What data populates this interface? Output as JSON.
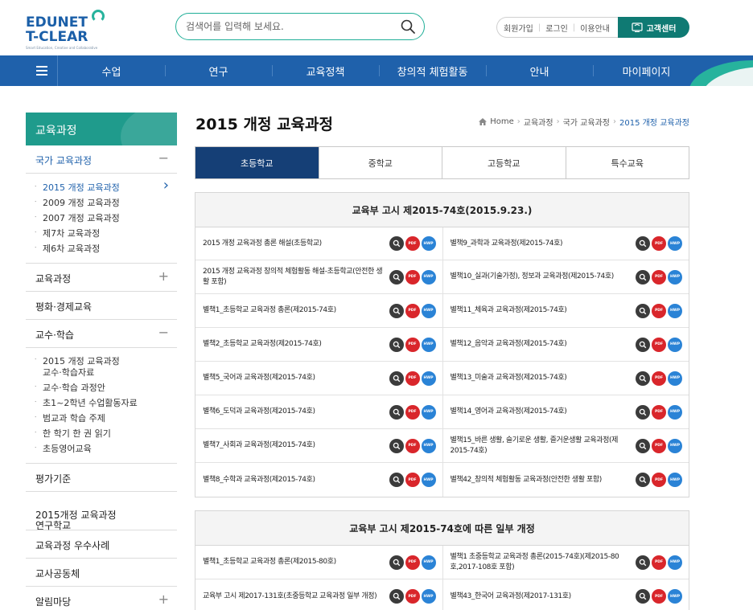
{
  "header": {
    "logo_line1": "EDUNET",
    "logo_line2": "T-CLEAR",
    "logo_tagline": "Smart Education, Creative and Collaborative",
    "search_placeholder": "검색어를 입력해 보세요.",
    "util_links": [
      "회원가입",
      "로그인",
      "이용안내"
    ],
    "customer_center": "고객센터"
  },
  "gnb": {
    "items": [
      "수업",
      "연구",
      "교육정책",
      "창의적 체험활동",
      "안내",
      "마이페이지"
    ]
  },
  "sidebar": {
    "title": "교육과정",
    "groups": [
      {
        "label": "국가 교육과정",
        "toggle": "−",
        "open": true,
        "items": [
          "2015 개정 교육과정",
          "2009 개정 교육과정",
          "2007 개정 교육과정",
          "제7차 교육과정",
          "제6차 교육과정"
        ]
      },
      {
        "label": "교육과정",
        "toggle": "+"
      },
      {
        "label": "평화·경제교육",
        "toggle": ""
      },
      {
        "label": "교수·학습",
        "toggle": "−",
        "open": true,
        "items": [
          "2015 개정 교육과정\n교수·학습자료",
          "교수·학습 과정안",
          "초1~2학년 수업활동자료",
          "범교과 학습 주제",
          "한 학기 한 권 읽기",
          "초등영어교육"
        ]
      },
      {
        "label": "평가기준",
        "toggle": ""
      },
      {
        "label": "2015개정 교육과정\n연구학교",
        "toggle": ""
      },
      {
        "label": "교육과정 우수사례",
        "toggle": ""
      },
      {
        "label": "교사공동체",
        "toggle": ""
      },
      {
        "label": "알림마당",
        "toggle": "+"
      }
    ]
  },
  "page": {
    "title": "2015 개정 교육과정",
    "breadcrumb": [
      "Home",
      "교육과정",
      "국가 교육과정",
      "2015 개정 교육과정"
    ]
  },
  "tabs": [
    "초등학교",
    "중학교",
    "고등학교",
    "특수교육"
  ],
  "icon_labels": {
    "view": "",
    "pdf": "PDF",
    "hwp": "HWP"
  },
  "sections": [
    {
      "heading": "교육부 고시 제2015-74호(2015.9.23.)",
      "rows": [
        [
          "2015 개정 교육과정 총론 해설(초등학교)",
          "별책9_과학과 교육과정(제2015-74호)"
        ],
        [
          "2015 개정 교육과정 창의적 체험활동 해설-초등학교(안전한 생활 포함)",
          "별책10_실과(기술가정), 정보과 교육과정(제2015-74호)"
        ],
        [
          "별책1_초등학교 교육과정 총론(제2015-74호)",
          "별책11_체육과 교육과정(제2015-74호)"
        ],
        [
          "별책2_초등학교 교육과정(제2015-74호)",
          "별책12_음악과 교육과정(제2015-74호)"
        ],
        [
          "별책5_국어과 교육과정(제2015-74호)",
          "별책13_미술과 교육과정(제2015-74호)"
        ],
        [
          "별책6_도덕과 교육과정(제2015-74호)",
          "별책14_영어과 교육과정(제2015-74호)"
        ],
        [
          "별책7_사회과 교육과정(제2015-74호)",
          "별책15_바른 생활, 슬기로운 생활, 즐거운생활 교육과정(제2015-74호)"
        ],
        [
          "별책8_수학과 교육과정(제2015-74호)",
          "별책42_창의적 체험활동 교육과정(안전한 생활 포함)"
        ]
      ]
    },
    {
      "heading": "교육부 고시 제2015-74호에 따른 일부 개정",
      "rows": [
        [
          "별책1_초등학교 교육과정 총론(제2015-80호)",
          "별책1 초중등학교 교육과정 총론(2015-74호)(제2015-80호,2017-108호 포함)"
        ],
        [
          "교육부 고시 제2017-131호(초중등학교 교육과정 일부 개정)",
          "별책43_한국어 교육과정(제2017-131호)"
        ]
      ]
    }
  ]
}
